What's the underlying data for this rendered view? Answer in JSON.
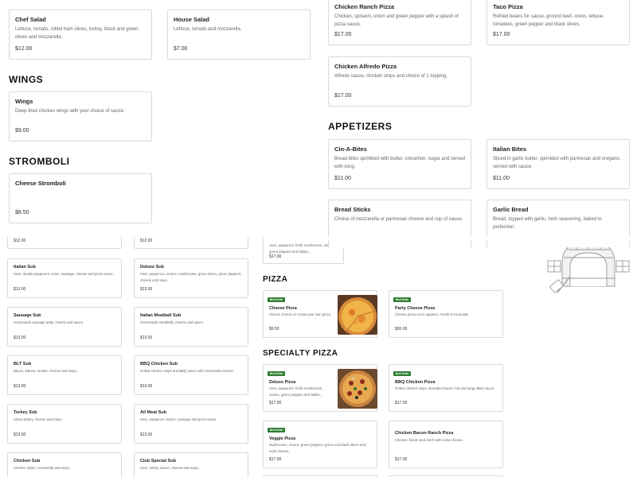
{
  "top_left_cards": [
    {
      "name": "Chef Salad",
      "desc": "Lettuce, tomato, rolled ham slices, turkey, black and green olives and mozzarella.",
      "price": "$12.00"
    },
    {
      "name": "House Salad",
      "desc": "Lettuce, tomato and mozzarella.",
      "price": "$7.00"
    }
  ],
  "wings": {
    "heading": "WINGS",
    "items": [
      {
        "name": "Wings",
        "desc": "Deep-fried chicken wings with your choice of sauce.",
        "price": "$9.00"
      }
    ]
  },
  "stromboli": {
    "heading": "STROMBOLI",
    "items": [
      {
        "name": "Cheese Stromboli",
        "desc": "",
        "price": "$8.50"
      }
    ]
  },
  "top_right_cards": [
    {
      "name": "Chicken Ranch Pizza",
      "desc": "Chicken, spinach, onion and green pepper with a splash of pizza sauce.",
      "price": "$17.00"
    },
    {
      "name": "Taco Pizza",
      "desc": "Refried beans for sauce, ground beef, onion, lettuce, tomatoes, green pepper and black olives.",
      "price": "$17.00"
    },
    {
      "name": "Chicken Alfredo Pizza",
      "desc": "Alfredo sauce, chicken strips and choice of 1 topping.",
      "price": "$17.00"
    }
  ],
  "appetizers": {
    "heading": "APPETIZERS",
    "items": [
      {
        "name": "Cin-A-Bites",
        "desc": "Bread bites sprinkled with butter, cinnamon, sugar and served with icing.",
        "price": "$11.00"
      },
      {
        "name": "Italian Bites",
        "desc": "Sliced in garlic butter, sprinkled with parmesan and oregano, served with sauce.",
        "price": "$11.00"
      },
      {
        "name": "Bread Sticks",
        "desc": "Choice of mozzarella or parmesan cheese and cup of sauce.",
        "price": ""
      },
      {
        "name": "Garlic Bread",
        "desc": "Bread, topped with garlic, herb seasoning, baked to perfection.",
        "price": ""
      }
    ]
  },
  "subs_left": [
    {
      "name": "",
      "desc": "",
      "price": "$12.00"
    },
    {
      "name": "Italian Sub",
      "desc": "Ham, double pepperoni, onion, sausage, cheese and pizza sauce.",
      "price": "$13.00"
    },
    {
      "name": "Sausage Sub",
      "desc": "Homemade sausage patty, cheese and sauce.",
      "price": "$13.00"
    },
    {
      "name": "BLT Sub",
      "desc": "Bacon, lettuce, tomato, cheese and mayo.",
      "price": "$13.00"
    },
    {
      "name": "Turkey Sub",
      "desc": "Sliced turkey, cheese and mayo.",
      "price": "$13.00"
    },
    {
      "name": "Chicken Sub",
      "desc": "Chicken strips, mozzarella and mayo.",
      "price": ""
    }
  ],
  "subs_right": [
    {
      "name": "",
      "desc": "",
      "price": "$12.00"
    },
    {
      "name": "Deluxe Sub",
      "desc": "Ham, pepperoni, onions, mushrooms, green olives, green peppers, cheese and mayo.",
      "price": "$13.00"
    },
    {
      "name": "Italian Meatball Sub",
      "desc": "Homemade meatballs, cheese and sauce.",
      "price": "$13.00"
    },
    {
      "name": "BBQ Chicken Sub",
      "desc": "Grilled chicken strips and BBQ sauce with mozzarella cheese.",
      "price": "$13.00"
    },
    {
      "name": "All Meat Sub",
      "desc": "Ham, pepperoni, bacon, sausage and pizza sauce.",
      "price": "$13.50"
    },
    {
      "name": "Club Special Sub",
      "desc": "Ham, turkey, bacon, cheese and mayo.",
      "price": ""
    }
  ],
  "partial_card": {
    "desc": "Ham, pepperoni, fresh mushrooms, onions, green peppers and Italian...",
    "price": "$17.00"
  },
  "pizza": {
    "heading": "PIZZA",
    "items": [
      {
        "badge": "Best Seller",
        "name": "Cheese Pizza",
        "desc": "Classic cheese or create your own pizza.",
        "price": "$9.50"
      },
      {
        "badge": "Best Seller",
        "name": "Party Cheese Pizza",
        "desc": "Cheese pizza cut in squares. Feeds 8-10 people",
        "price": "$30.00"
      }
    ]
  },
  "specialty": {
    "heading": "SPECIALTY PIZZA",
    "items": [
      {
        "badge": "Best Seller",
        "name": "Deluxe Pizza",
        "desc": "Ham, pepperoni, fresh mushrooms, onions, green peppers and Italian...",
        "price": "$17.00"
      },
      {
        "badge": "Best Seller",
        "name": "BBQ Chicken Pizza",
        "desc": "Grilled chicken strips, shredded bacon, hot and tangy BBQ sauce.",
        "price": "$17.00"
      },
      {
        "badge": "Best Seller",
        "name": "Veggie Pizza",
        "desc": "Mushrooms, onions, green peppers, green and black olives and extra cheese.",
        "price": "$17.00"
      },
      {
        "badge": "",
        "name": "Chicken Bacon Ranch Pizza",
        "desc": "Chicken, bacon and ranch with extra cheese.",
        "price": "$17.00"
      }
    ]
  },
  "colors": {
    "badge": "#2e7d32",
    "border": "#d9d9d9",
    "illustration": "#9a9a9a"
  }
}
